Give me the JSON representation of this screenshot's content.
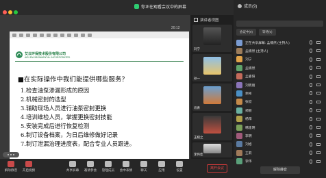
{
  "top_bar": {
    "share_status": "你正在观看会议中的屏幕"
  },
  "presentation": {
    "time": "20:12",
    "slide": {
      "company_cn": "艾云环保技术股份有限公司",
      "company_en": "AISI ENVIRONMENTAL INCORPORATED",
      "heading": "■在实际操作中我们能提供哪些服务？",
      "items": [
        "1.检查油泵渗漏形成的原因",
        "2.机械密封的选型",
        "3.辅助现场人员进行油泵密封更换",
        "4.培训维检人员，掌握更换密封技能",
        "5.安装完成后进行恢复检测",
        "6.制订设备档案，为日后维修做好记录",
        "7.制订泄漏治理进度表，配合专业人员跟进。"
      ]
    }
  },
  "video_strip": {
    "header": "演讲者视图",
    "tiles": [
      {
        "name": "刘宁"
      },
      {
        "name": "孙一"
      },
      {
        "name": "肖青"
      },
      {
        "name": "王婉之"
      },
      {
        "name": "李伟佳"
      },
      {
        "name": "苏洁"
      }
    ]
  },
  "members": {
    "title": "成员(9)",
    "search_placeholder": "",
    "tabs": [
      "会议中(9)",
      "等待(0)"
    ],
    "list": [
      {
        "name": "正在共享屏幕: 孟楠然 (主持人)",
        "color": "#7a9bd1"
      },
      {
        "name": "孟楠然 (主持人)",
        "color": "#9c7c5a"
      },
      {
        "name": "刘宁",
        "color": "#e0a34a"
      },
      {
        "name": "孟楠然",
        "color": "#5fa36a"
      },
      {
        "name": "孟睿阳",
        "color": "#c46a5a"
      },
      {
        "name": "刘晓丽",
        "color": "#8a74b8"
      },
      {
        "name": "余彬",
        "color": "#4a8fc4"
      },
      {
        "name": "张欣",
        "color": "#c48a4a"
      },
      {
        "name": "郑丽",
        "color": "#6ab0a0"
      },
      {
        "name": "杨阳",
        "color": "#b0a04a"
      },
      {
        "name": "韩建明",
        "color": "#7aa05a"
      },
      {
        "name": "李明",
        "color": "#a05a7a"
      },
      {
        "name": "刘旭",
        "color": "#5a7aa0"
      },
      {
        "name": "王莉",
        "color": "#a07a5a"
      },
      {
        "name": "李伟",
        "color": "#5aa07a"
      }
    ],
    "unmute_all": "解除静音"
  },
  "toolbar": {
    "buttons": [
      {
        "label": "解除静音",
        "icon": "mic-off-icon"
      },
      {
        "label": "开启视频",
        "icon": "video-off-icon"
      },
      {
        "label": "共享屏幕",
        "icon": "share-screen-icon"
      },
      {
        "label": "邀请参会",
        "icon": "invite-icon"
      },
      {
        "label": "管理成员",
        "icon": "members-icon"
      },
      {
        "label": "会中表情",
        "icon": "emoji-icon"
      },
      {
        "label": "聊天",
        "icon": "chat-icon"
      },
      {
        "label": "应用",
        "icon": "apps-icon"
      },
      {
        "label": "设置",
        "icon": "settings-icon"
      }
    ],
    "end_label": "离开会议"
  }
}
